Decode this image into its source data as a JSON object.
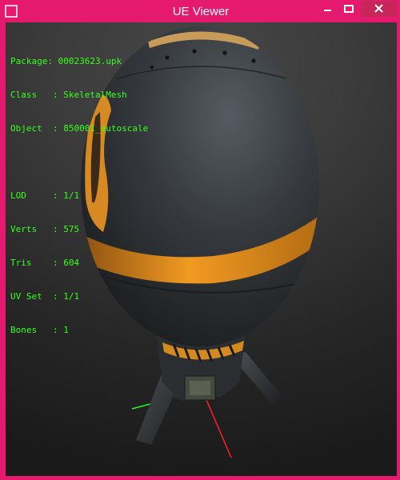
{
  "window": {
    "title": "UE Viewer"
  },
  "info": {
    "package_label": "Package: ",
    "package": "00023623.upk",
    "class_label": "Class   : ",
    "class": "SkeletalMesh",
    "object_label": "Object  : ",
    "object": "850001_autoscale",
    "lod_label": "LOD     : ",
    "lod": "1/1",
    "verts_label": "Verts   : ",
    "verts": "575",
    "tris_label": "Tris    : ",
    "tris": "604",
    "uvset_label": "UV Set  : ",
    "uvset": "1/1",
    "bones_label": "Bones   : ",
    "bones": "1"
  },
  "colors": {
    "titlebar": "#e5196e",
    "close_button": "#c7265a",
    "info_text": "#39ff1f",
    "mesh_body": "#2e3236",
    "mesh_stripe": "#e08a1a",
    "axis_x": "#ff2020",
    "axis_y": "#20ff20"
  }
}
